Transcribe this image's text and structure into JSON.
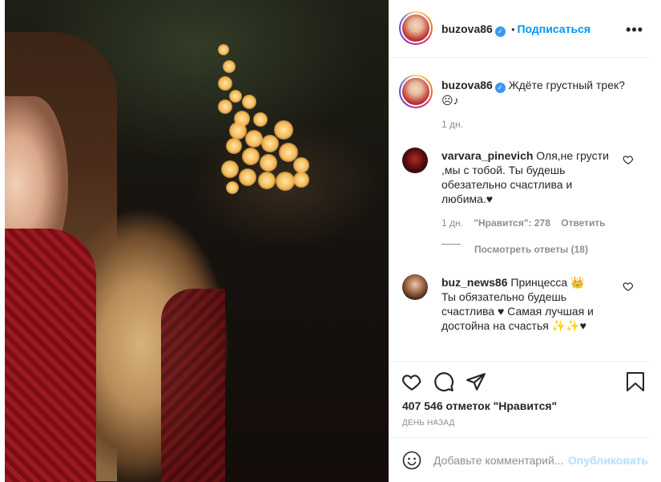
{
  "post": {
    "author": "buzova86",
    "follow_label": "Подписаться",
    "dot_sep": "•",
    "more_label": "•••",
    "caption_user": "buzova86",
    "caption_text": "Ждёте грустный трек?",
    "caption_emoji": "☹♪",
    "caption_time": "1 дн."
  },
  "comments": [
    {
      "user": "varvara_pinevich",
      "text": "Оля,не грусти ,мы с тобой. Ты будешь обезательно счастлива и любима.♥",
      "time": "1 дн.",
      "likes": "\"Нравится\": 278",
      "reply": "Ответить",
      "view_replies": "Посмотреть ответы (18)"
    },
    {
      "user": "buz_news86",
      "text": "Принцесса 👑 Ты обязательно будешь счастлива ♥ Самая лучшая и достойна на счастья ✨✨♥"
    }
  ],
  "footer": {
    "likes_count": "407 546 отметок \"Нравится\"",
    "time_ago": "ДЕНЬ НАЗАД",
    "comment_placeholder": "Добавьте комментарий...",
    "publish_label": "Опубликовать"
  },
  "icons": {
    "like": "heart-icon",
    "comment": "comment-icon",
    "share": "share-icon",
    "save": "bookmark-icon",
    "emoji": "smiley-icon",
    "verified": "verified-badge-icon"
  },
  "colors": {
    "accent": "#0095f6",
    "muted": "#8e8e8e",
    "publish_disabled": "#b2dffc",
    "text": "#262626"
  }
}
